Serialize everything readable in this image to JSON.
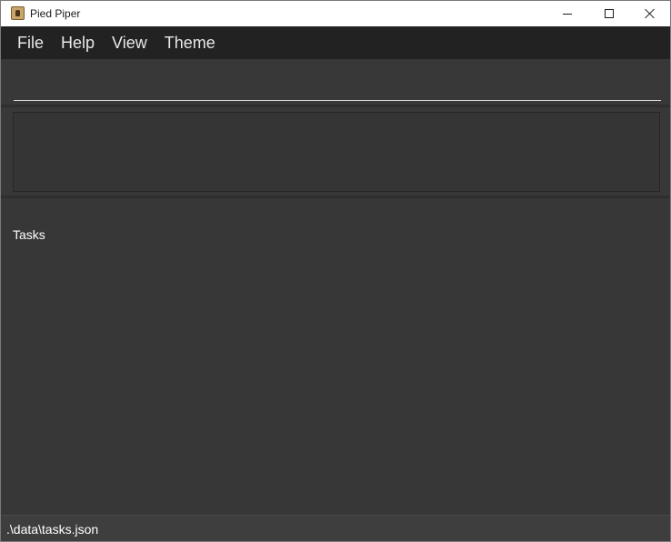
{
  "window": {
    "title": "Pied Piper",
    "icon": "app-icon",
    "controls": {
      "minimize": "minimize-icon",
      "maximize": "maximize-icon",
      "close": "close-icon"
    }
  },
  "menu": {
    "items": [
      {
        "label": "File"
      },
      {
        "label": "Help"
      },
      {
        "label": "View"
      },
      {
        "label": "Theme"
      }
    ]
  },
  "command": {
    "value": "",
    "placeholder": ""
  },
  "result": {
    "text": ""
  },
  "tasks": {
    "label": "Tasks"
  },
  "status": {
    "path": ".\\data\\tasks.json"
  },
  "colors": {
    "background": "#383838",
    "menubar": "#222222",
    "titlebar": "#ffffff",
    "text": "#ffffff"
  }
}
